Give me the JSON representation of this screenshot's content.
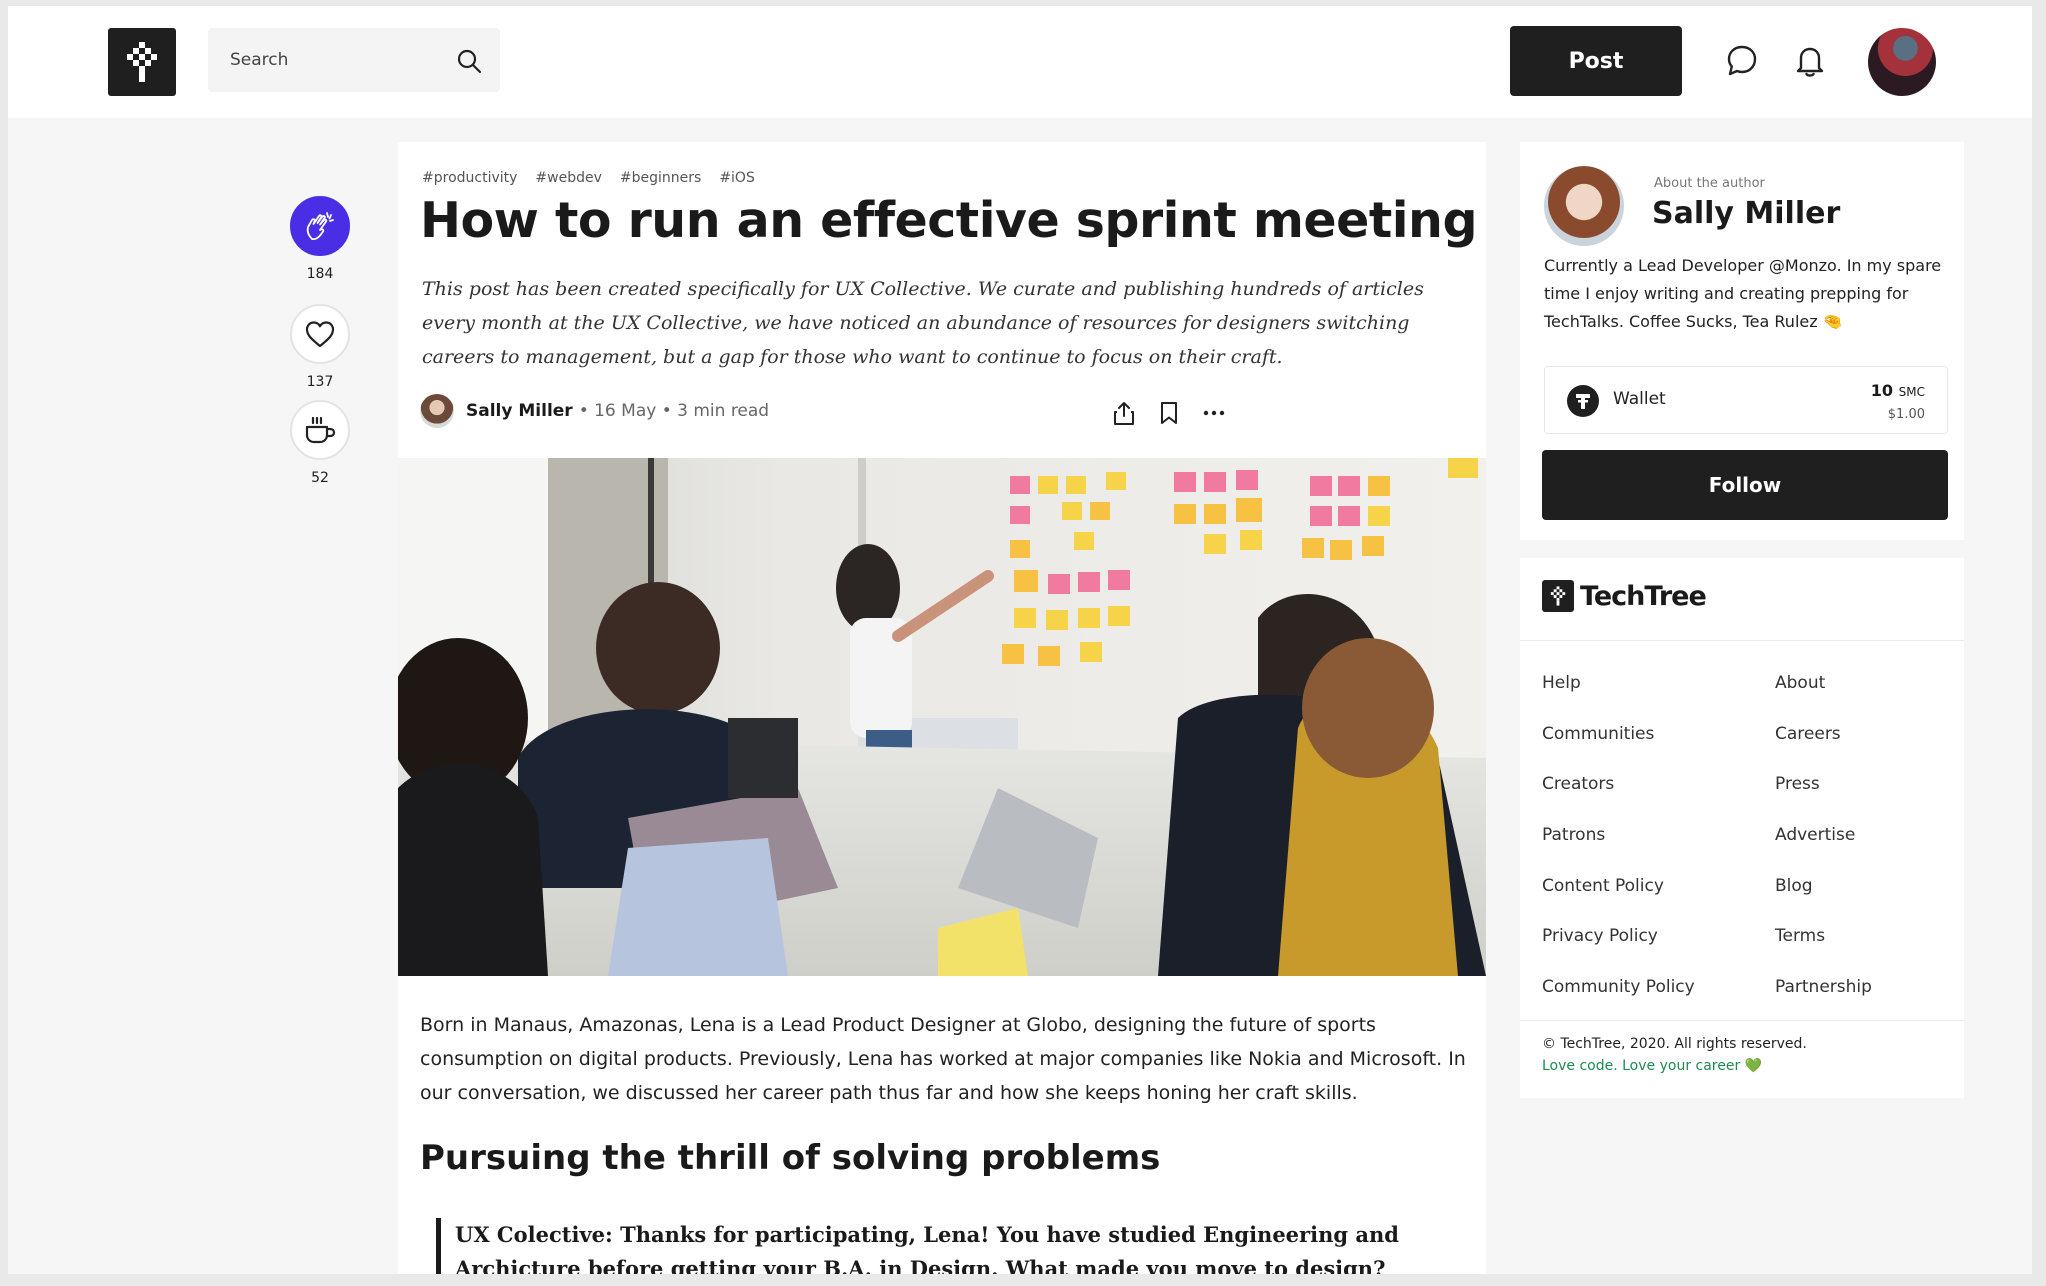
{
  "header": {
    "search_placeholder": "Search",
    "post_label": "Post"
  },
  "reactions": [
    {
      "icon": "clap-icon",
      "count": "184",
      "active": true
    },
    {
      "icon": "heart-icon",
      "count": "137",
      "active": false
    },
    {
      "icon": "coffee-icon",
      "count": "52",
      "active": false
    }
  ],
  "article": {
    "tags": [
      "#productivity",
      "#webdev",
      "#beginners",
      "#iOS"
    ],
    "title": "How to run an effective sprint meeting",
    "subtitle": "This post has been created specifically for UX Collective. We curate and publishing hundreds of articles every month at the UX Collective, we have noticed an abundance of resources for designers switching careers to management, but a gap for those who want to continue to focus on their craft.",
    "author": "Sally Miller",
    "meta": "• 16 May • 3 min read",
    "body": "Born in Manaus, Amazonas, Lena is a Lead Product Designer at Globo, designing the future of sports consumption on digital products. Previously, Lena has worked at major companies like Nokia and Microsoft. In our conversation, we discussed her career path thus far and how she keeps honing her craft skills.",
    "heading": "Pursuing the thrill of solving problems",
    "quote": "UX Colective: Thanks for participating, Lena! You have studied Engineering and Archicture before getting your B.A. in Design. What made you move to design?"
  },
  "author_card": {
    "about_label": "About the author",
    "name": "Sally Miller",
    "bio": "Currently a Lead Developer @Monzo. In my spare time I enjoy writing and creating prepping for TechTalks. Coffee Sucks, Tea Rulez 🤏",
    "wallet_label": "Wallet",
    "wallet_amount": "10",
    "wallet_unit": "SMC",
    "wallet_usd": "$1.00",
    "follow_label": "Follow"
  },
  "footer": {
    "brand": "TechTree",
    "links_left": [
      "Help",
      "Communities",
      "Creators",
      "Patrons",
      "Content Policy",
      "Privacy Policy",
      "Community Policy"
    ],
    "links_right": [
      "About",
      "Careers",
      "Press",
      "Advertise",
      "Blog",
      "Terms",
      "Partnership"
    ],
    "copyright": "© TechTree, 2020. All rights reserved.",
    "tagline": "Love code. Love your career 💚"
  },
  "colors": {
    "accent": "#4a2ee6",
    "dark": "#1f1f1f",
    "tagline_green": "#1f8a52"
  }
}
